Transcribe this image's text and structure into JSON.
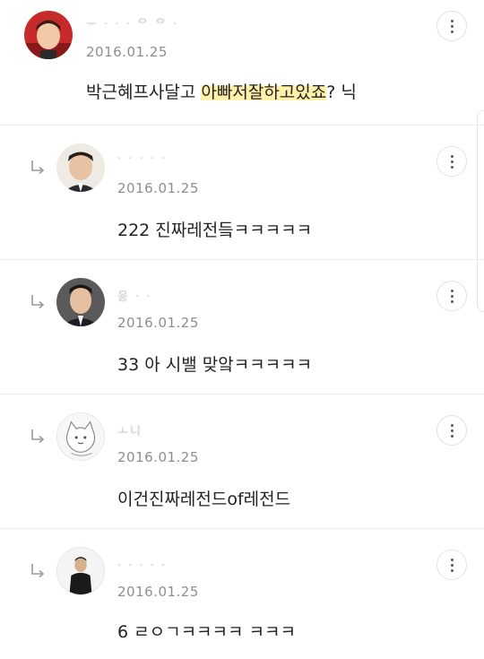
{
  "comments": [
    {
      "username": "ᅮ  ·  ·  ·  ᄋ ᄋ ·",
      "date": "2016.01.25",
      "text_before": "박근혜프사달고 ",
      "text_highlight": "아빠저잘하고있죠",
      "text_after": "? 닉",
      "is_reply": false
    },
    {
      "username": "·  ·  ·  ·  ·",
      "date": "2016.01.25",
      "text": "222 진짜레전듴ㅋㅋㅋㅋㅋ",
      "is_reply": true
    },
    {
      "username": "응  ·  ·",
      "date": "2016.01.25",
      "text": "33 아 시밸 맞앜ㅋㅋㅋㅋㅋ",
      "is_reply": true
    },
    {
      "username": "ㅗ니",
      "date": "2016.01.25",
      "text": "이건진짜레전드of레전드",
      "is_reply": true
    },
    {
      "username": "·  ·  ·  ·  ·  ᅟᅟᅟ",
      "date": "2016.01.25",
      "text": "6 ㄹㅇㄱㅋㅋㅋㅋ ㅋㅋㅋ",
      "is_reply": true
    }
  ],
  "icons": {
    "reply": "reply-arrow-icon",
    "more": "more-vertical-icon"
  },
  "colors": {
    "highlight": "#fff2a8",
    "divider": "#ececec",
    "date": "#8e8e8e"
  }
}
